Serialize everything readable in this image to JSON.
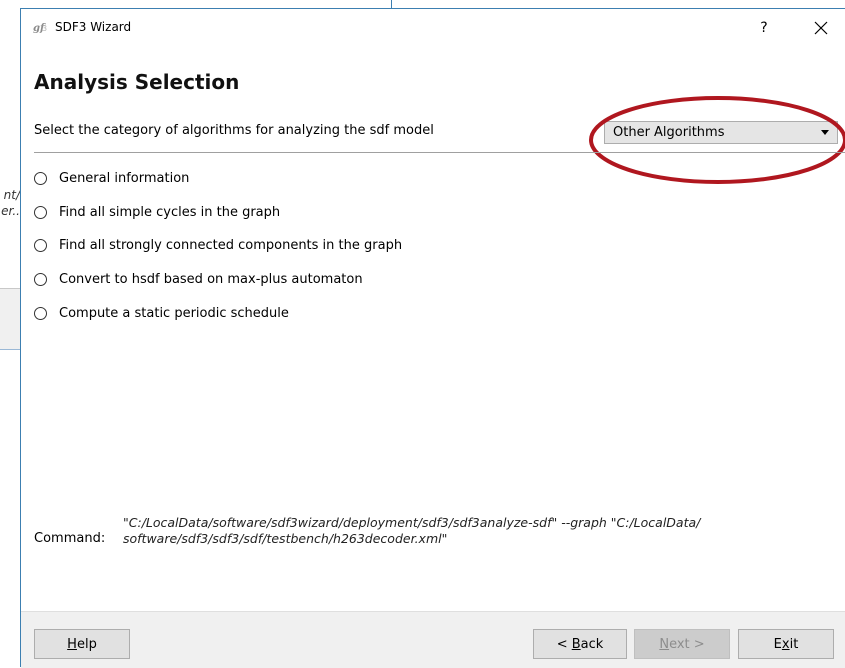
{
  "window": {
    "title": "SDF3 Wizard",
    "help_glyph": "?",
    "close_icon": "close-icon",
    "app_icon": "sdf3-app-icon"
  },
  "background_window": {
    "text_line_1": "nt/",
    "text_line_2": "er.."
  },
  "page": {
    "heading": "Analysis Selection",
    "prompt": "Select the category of algorithms for analyzing the sdf model"
  },
  "category_select": {
    "selected": "Other Algorithms",
    "highlight_color": "#b0171f"
  },
  "options": [
    {
      "label": "General information",
      "selected": false
    },
    {
      "label": "Find all simple cycles in the graph",
      "selected": false
    },
    {
      "label": "Find all strongly connected components in the graph",
      "selected": false
    },
    {
      "label": "Convert to hsdf based on max-plus automaton",
      "selected": false
    },
    {
      "label": "Compute a static periodic schedule",
      "selected": false
    }
  ],
  "command": {
    "label": "Command:",
    "line_1": "\"C:/LocalData/software/sdf3wizard/deployment/sdf3/sdf3analyze-sdf\" --graph \"C:/LocalData/",
    "line_2": "software/sdf3/sdf3/sdf/testbench/h263decoder.xml\""
  },
  "buttons": {
    "help": {
      "label": "Help",
      "mnemonic": "H",
      "rest": "elp",
      "enabled": true
    },
    "back": {
      "label": "< Back",
      "prefix": "< ",
      "mnemonic": "B",
      "rest": "ack",
      "enabled": true
    },
    "next": {
      "label": "Next >",
      "mnemonic": "N",
      "rest": "ext >",
      "enabled": false
    },
    "exit": {
      "label": "Exit",
      "prefix": "E",
      "mnemonic": "x",
      "rest": "it",
      "enabled": true
    }
  }
}
